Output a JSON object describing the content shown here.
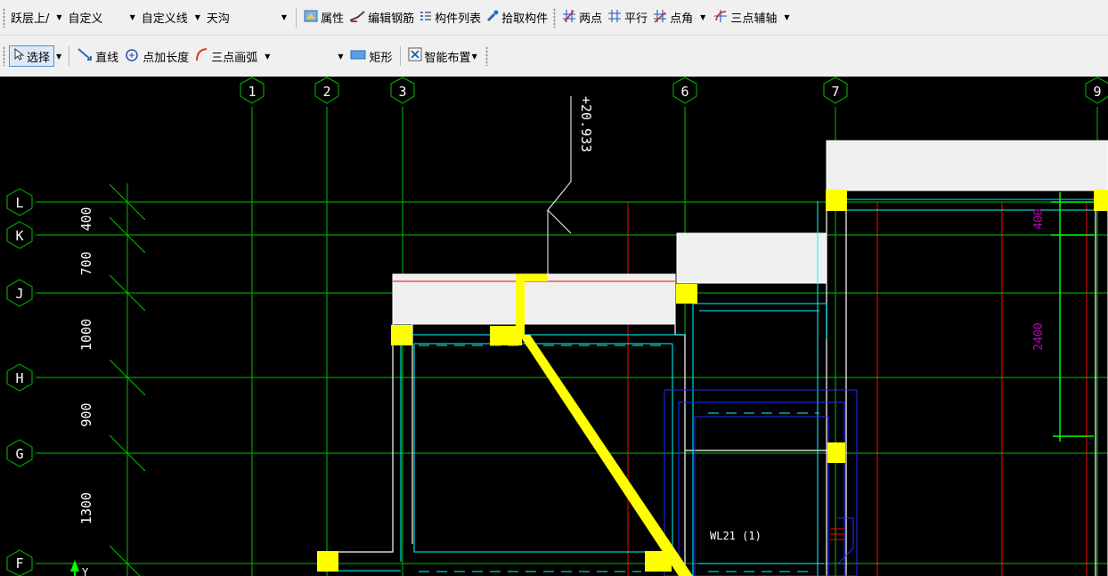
{
  "toolbar1": {
    "combo_floor": "跃层上/",
    "combo_custom": "自定义",
    "combo_custom_line": "自定义线",
    "combo_component": "天沟",
    "properties_label": "属性",
    "edit_rebar_label": "编辑钢筋",
    "component_list_label": "构件列表",
    "pick_component_label": "拾取构件",
    "two_points_label": "两点",
    "parallel_label": "平行",
    "point_angle_label": "点角",
    "three_point_axis_label": "三点辅轴"
  },
  "toolbar2": {
    "select_label": "选择",
    "line_label": "直线",
    "point_length_label": "点加长度",
    "three_point_arc_label": "三点画弧",
    "rectangle_label": "矩形",
    "smart_layout_label": "智能布置"
  },
  "drawing": {
    "col_axes": [
      "1",
      "2",
      "3",
      "6",
      "7",
      "9"
    ],
    "row_axes": [
      "L",
      "K",
      "J",
      "H",
      "G",
      "F"
    ],
    "row_spacings": [
      "400",
      "700",
      "1000",
      "900",
      "1300"
    ],
    "elevation": "+20.933",
    "dim_right_small": "400",
    "dim_right_large": "2400",
    "beam_label": "WL21 (1)",
    "ucs_label": "Y",
    "colors": {
      "axis": "#00c000",
      "red_line": "#ff0000",
      "cyan": "#00ffff",
      "yellow": "#ffff00",
      "blue": "#2030ff",
      "magenta": "#c000c0",
      "white": "#ffffff"
    }
  }
}
